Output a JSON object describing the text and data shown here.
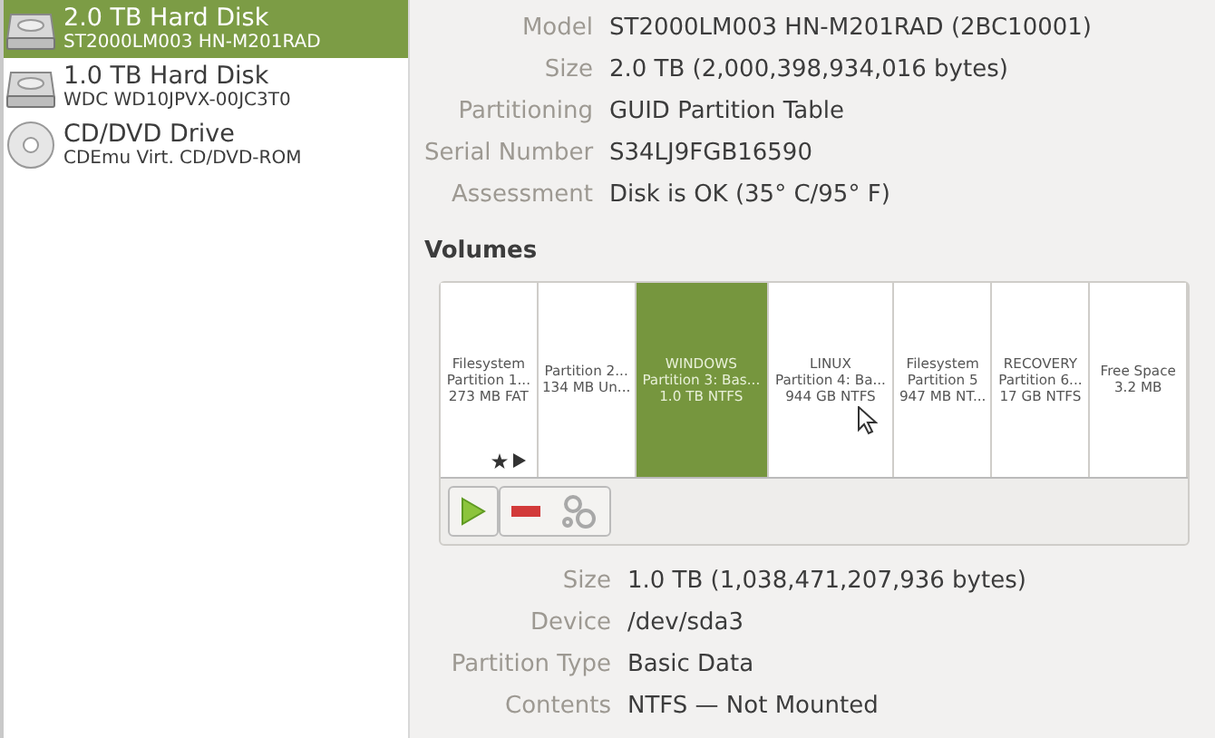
{
  "disks": [
    {
      "title": "2.0 TB Hard Disk",
      "subtitle": "ST2000LM003 HN-M201RAD",
      "kind": "hdd",
      "selected": true
    },
    {
      "title": "1.0 TB Hard Disk",
      "subtitle": "WDC WD10JPVX-00JC3T0",
      "kind": "hdd",
      "selected": false
    },
    {
      "title": "CD/DVD Drive",
      "subtitle": "CDEmu Virt. CD/DVD-ROM",
      "kind": "optical",
      "selected": false
    }
  ],
  "disk_details": [
    {
      "label": "Model",
      "value": "ST2000LM003 HN-M201RAD (2BC10001)"
    },
    {
      "label": "Size",
      "value": "2.0 TB (2,000,398,934,016 bytes)"
    },
    {
      "label": "Partitioning",
      "value": "GUID Partition Table"
    },
    {
      "label": "Serial Number",
      "value": "S34LJ9FGB16590"
    },
    {
      "label": "Assessment",
      "value": "Disk is OK (35° C/95° F)"
    }
  ],
  "volumes_heading": "Volumes",
  "partitions": [
    {
      "lines": [
        "Filesystem",
        "Partition 1...",
        "273 MB FAT"
      ],
      "selected": false
    },
    {
      "lines": [
        "Partition 2...",
        "134 MB Un..."
      ],
      "selected": false
    },
    {
      "lines": [
        "WINDOWS",
        "Partition 3: Bas...",
        "1.0 TB NTFS"
      ],
      "selected": true
    },
    {
      "lines": [
        "LINUX",
        "Partition 4: Ba...",
        "944 GB NTFS"
      ],
      "selected": false
    },
    {
      "lines": [
        "Filesystem",
        "Partition 5",
        "947 MB NT..."
      ],
      "selected": false
    },
    {
      "lines": [
        "RECOVERY",
        "Partition 6...",
        "17 GB NTFS"
      ],
      "selected": false
    },
    {
      "lines": [
        "Free Space",
        "3.2 MB"
      ],
      "selected": false
    }
  ],
  "volume_details": [
    {
      "label": "Size",
      "value": "1.0 TB (1,038,471,207,936 bytes)"
    },
    {
      "label": "Device",
      "value": "/dev/sda3"
    },
    {
      "label": "Partition Type",
      "value": "Basic Data"
    },
    {
      "label": "Contents",
      "value": "NTFS — Not Mounted"
    }
  ]
}
